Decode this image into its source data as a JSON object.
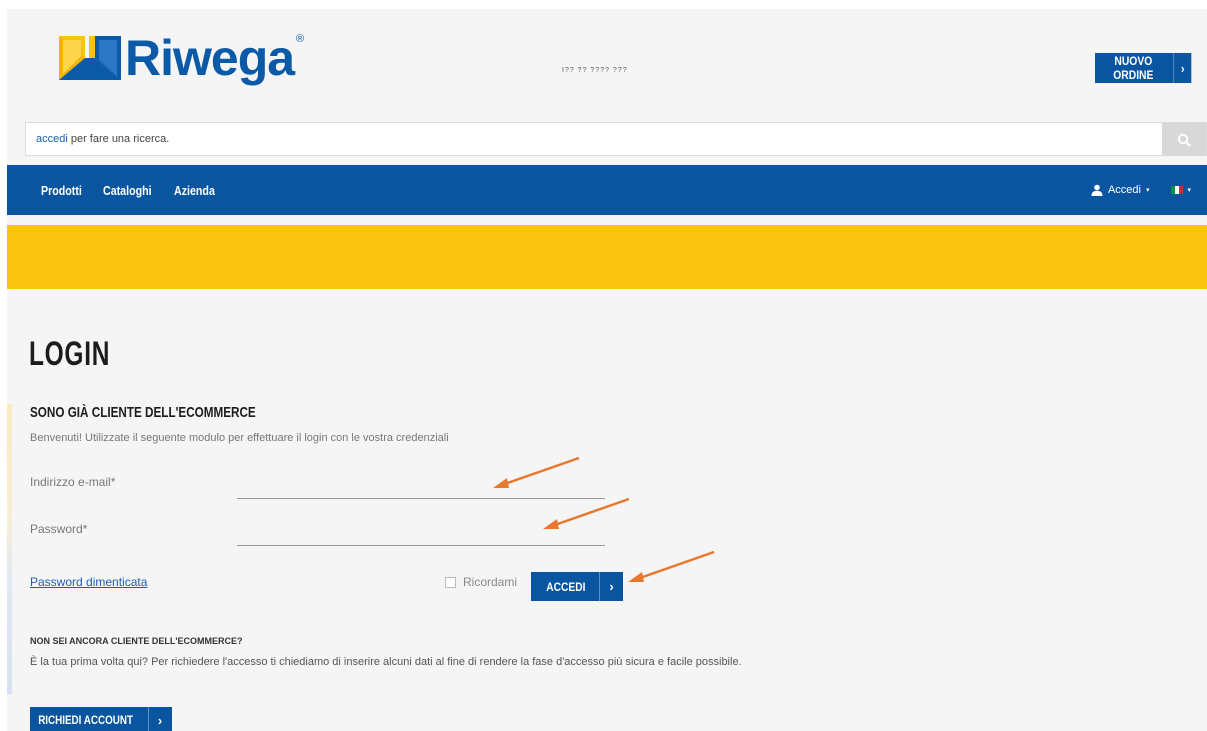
{
  "header": {
    "logo_text": "Riwega",
    "logo_reg": "®",
    "new_order_label": "NUOVO ORDINE",
    "chevron": "›"
  },
  "search": {
    "link_text": "accedi",
    "text": " per fare una ricerca.",
    "icon": "search-icon"
  },
  "nav": {
    "items": [
      {
        "label": "Prodotti"
      },
      {
        "label": "Cataloghi"
      },
      {
        "label": "Azienda"
      }
    ],
    "login_label": "Accedi",
    "caret": "▾",
    "language": "it"
  },
  "banner": {
    "color": "#f8c40e",
    "partial_text": "I?? ?? ???? ???"
  },
  "login": {
    "title": "LOGIN",
    "subtitle": "SONO GIÀ CLIENTE DELL'ECOMMERCE",
    "intro": "Benvenuti! Utilizzate il seguente modulo per effettuare il login con le vostra credenziali",
    "email_label": "Indirizzo e-mail*",
    "email_value": "",
    "password_label": "Password*",
    "password_value": "",
    "forgot_label": "Password dimenticata",
    "remember_label": "Ricordami",
    "remember_checked": false,
    "submit_label": "ACCEDI"
  },
  "register": {
    "title": "NON SEI ANCORA CLIENTE DELL'ECOMMERCE?",
    "text": "È la tua prima volta qui? Per richiedere l'accesso ti chiediamo di inserire alcuni dati al fine di rendere la fase d'accesso più sicura e facile possibile.",
    "button_label": "RICHIEDI ACCOUNT"
  },
  "colors": {
    "brand_blue": "#0a55a0",
    "brand_yellow": "#f8c40e",
    "annotation_arrow": "#e8782e"
  }
}
